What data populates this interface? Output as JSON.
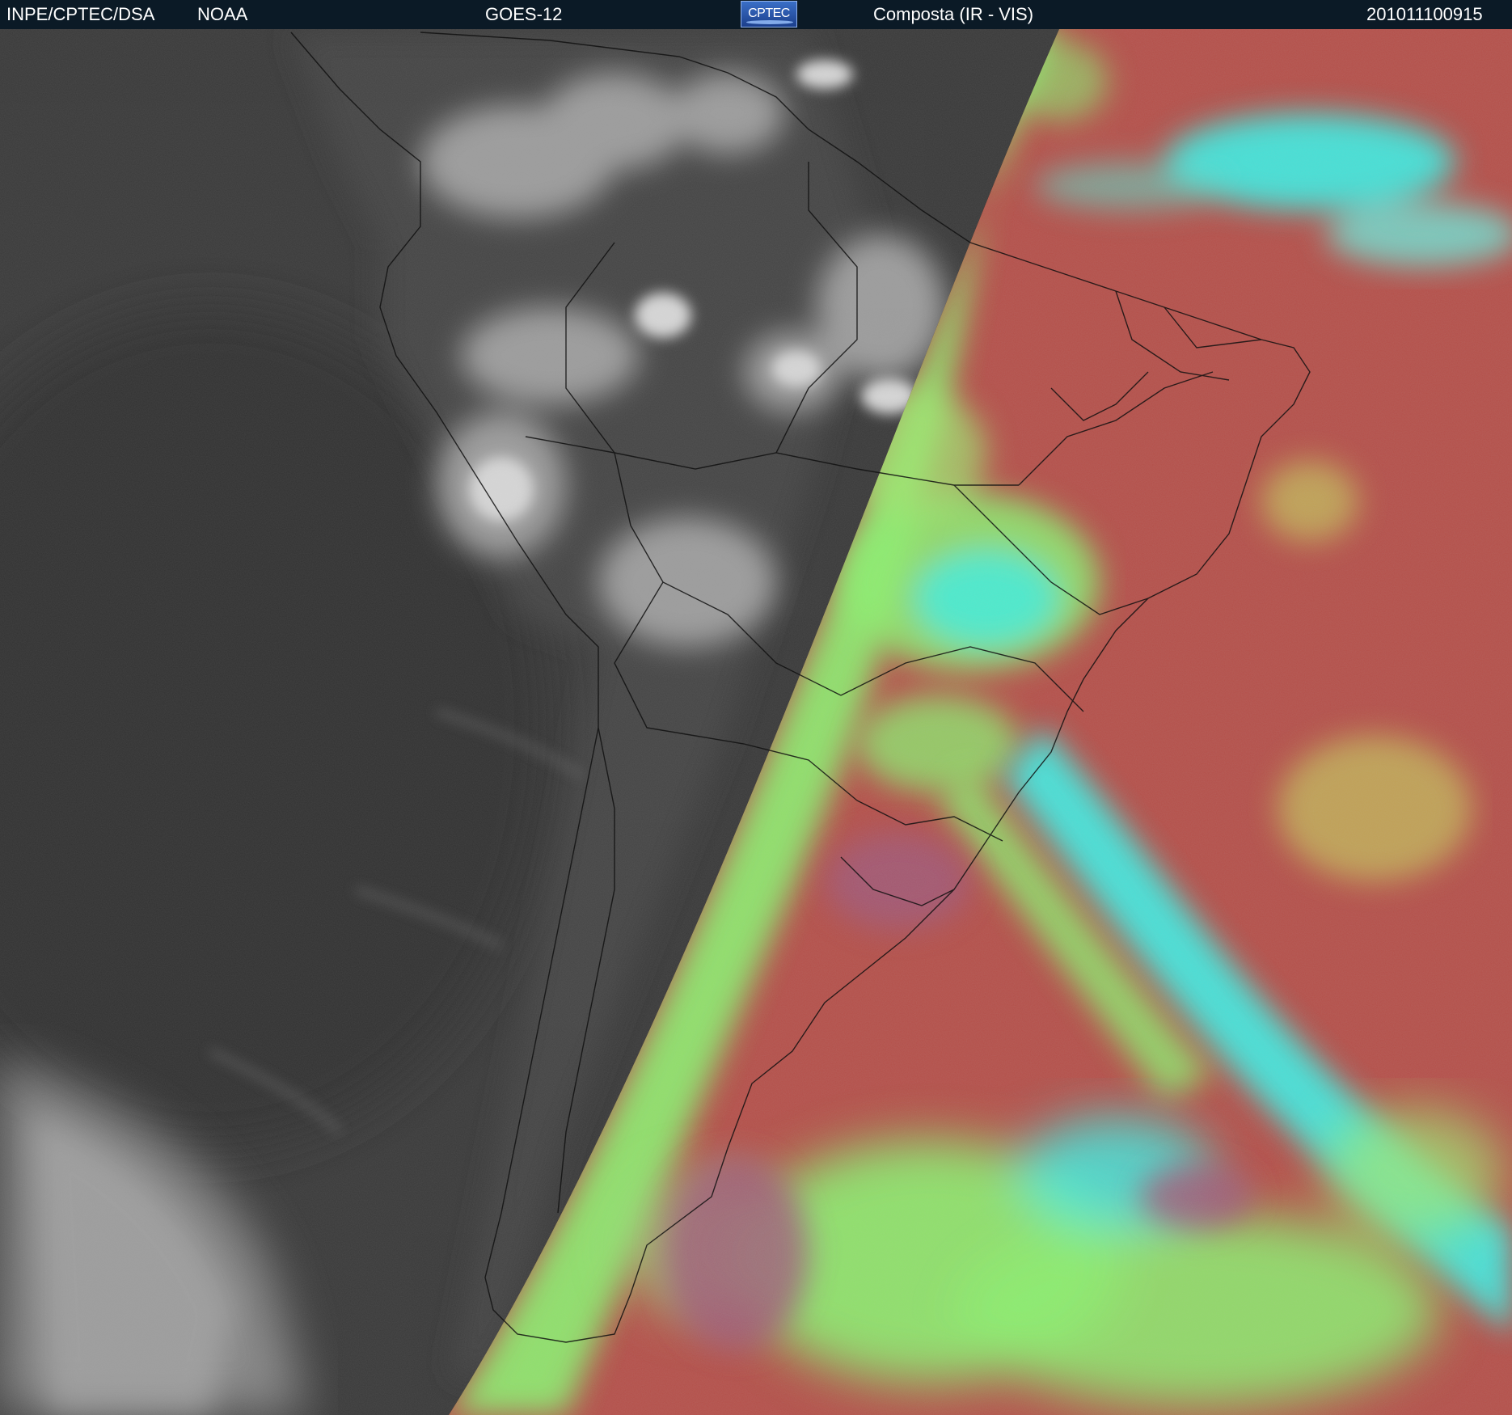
{
  "header": {
    "institution": "INPE/CPTEC/DSA",
    "agency": "NOAA",
    "satellite": "GOES-12",
    "logo_text": "CPTEC",
    "product": "Composta (IR - VIS)",
    "timestamp": "201011100915"
  },
  "map": {
    "night_side_color": "#3c3c3c",
    "day_land_color": "#b5504a",
    "cloud_cyan_color": "#3cf0e6",
    "cloud_green_color": "#8cf070",
    "header_bg_color": "#0b1a26"
  }
}
